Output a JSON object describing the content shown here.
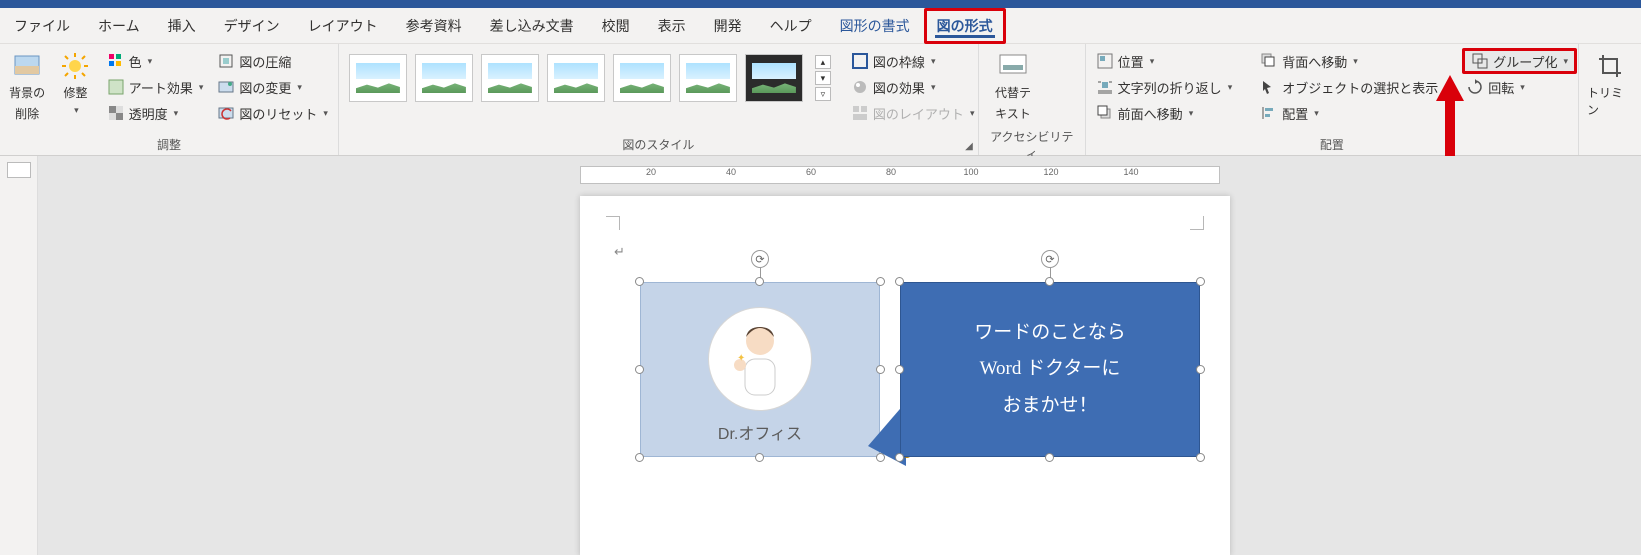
{
  "tabs": {
    "file": "ファイル",
    "home": "ホーム",
    "insert": "挿入",
    "design": "デザイン",
    "layout": "レイアウト",
    "references": "参考資料",
    "mailings": "差し込み文書",
    "review": "校閲",
    "view": "表示",
    "developer": "開発",
    "help": "ヘルプ",
    "shape_format": "図形の書式",
    "picture_format": "図の形式"
  },
  "ribbon": {
    "adjust": {
      "bg_remove1": "背景の",
      "bg_remove2": "削除",
      "corrections": "修整",
      "color": "色",
      "artistic": "アート効果",
      "transparency": "透明度",
      "compress": "図の圧縮",
      "change": "図の変更",
      "reset": "図のリセット",
      "group_label": "調整"
    },
    "styles": {
      "border": "図の枠線",
      "effects": "図の効果",
      "layout": "図のレイアウト",
      "group_label": "図のスタイル"
    },
    "accessibility": {
      "alt1": "代替テ",
      "alt2": "キスト",
      "group_label": "アクセシビリティ"
    },
    "arrange": {
      "position": "位置",
      "wrap": "文字列の折り返し",
      "bring_forward": "前面へ移動",
      "send_backward": "背面へ移動",
      "selection_pane": "オブジェクトの選択と表示",
      "align": "配置",
      "group": "グループ化",
      "rotate": "回転",
      "group_label": "配置"
    },
    "size": {
      "crop": "トリミン"
    }
  },
  "ruler": {
    "marks": [
      "20",
      "40",
      "60",
      "80",
      "100",
      "120",
      "140"
    ]
  },
  "document": {
    "shape1_caption": "Dr.オフィス",
    "shape2_line1": "ワードのことなら",
    "shape2_line2": "Word ドクターに",
    "shape2_line3": "おまかせ！"
  }
}
